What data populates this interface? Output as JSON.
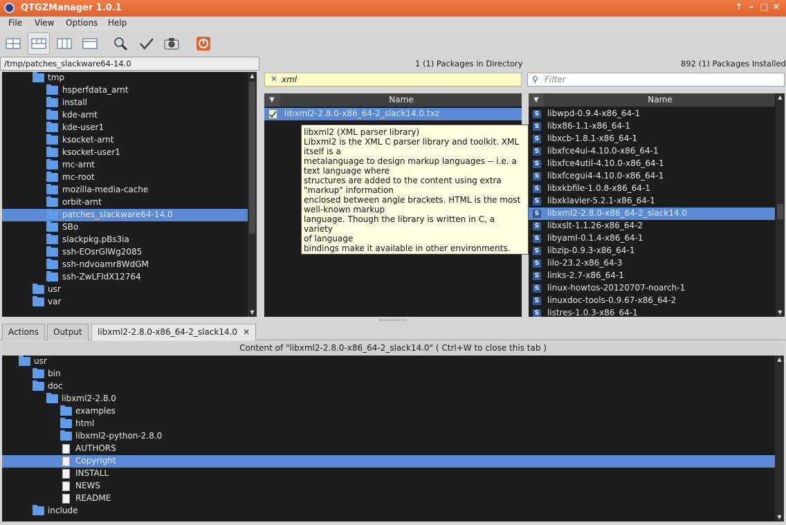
{
  "window": {
    "title": "QTGZManager 1.0.1",
    "controls": [
      "↑",
      "–",
      "□",
      "✕"
    ]
  },
  "menu": [
    "File",
    "View",
    "Options",
    "Help"
  ],
  "toolbar": [
    {
      "name": "view-layout-1-icon",
      "active": false
    },
    {
      "name": "view-layout-2-icon",
      "active": true
    },
    {
      "name": "view-layout-3-icon",
      "active": false
    },
    {
      "name": "view-layout-4-icon",
      "active": false
    },
    {
      "name": "find-icon",
      "active": false
    },
    {
      "name": "check-icon",
      "active": false
    },
    {
      "name": "snapshot-icon",
      "active": false
    },
    {
      "name": "exit-icon",
      "active": false
    }
  ],
  "directory": {
    "path": "/tmp/patches_slackware64-14.0",
    "items": [
      "tmp",
      "hsperfdata_arnt",
      "install",
      "kde-arnt",
      "kde-user1",
      "ksocket-arnt",
      "ksocket-user1",
      "mc-arnt",
      "mc-root",
      "mozilla-media-cache",
      "orbit-arnt",
      "patches_slackware64-14.0",
      "SBo",
      "slackpkg.pBs3ia",
      "ssh-EOsrGlWg2085",
      "ssh-ndvoamr8WdGM",
      "ssh-ZwLFIdX12764",
      "usr",
      "var"
    ],
    "selected": "patches_slackware64-14.0"
  },
  "packages_dir": {
    "count_label": "1 (1) Packages in Directory",
    "search_value": "xml",
    "column": "Name",
    "rows": [
      "libxml2-2.8.0-x86_64-2_slack14.0.txz"
    ]
  },
  "tooltip": {
    "lines": [
      "libxml2 (XML parser library)",
      "Libxml2 is the XML C parser library and toolkit. XML",
      "itself is a",
      "metalanguage to design markup languages -- i.e. a",
      "text language where",
      "structures are added to the content using extra",
      "\"markup\" information",
      "enclosed between angle brackets. HTML is the most",
      "well-known markup",
      "language. Though the library is written in C, a variety",
      "of language",
      "bindings make it available in other environments."
    ]
  },
  "installed": {
    "count_label": "892 (1) Packages Installed",
    "filter_placeholder": "Filter",
    "column": "Name",
    "rows": [
      "libwpd-0.9.4-x86_64-1",
      "libx86-1.1-x86_64-1",
      "libxcb-1.8.1-x86_64-1",
      "libxfce4ui-4.10.0-x86_64-1",
      "libxfce4util-4.10.0-x86_64-1",
      "libxfcegui4-4.10.0-x86_64-1",
      "libxkbfile-1.0.8-x86_64-1",
      "libxklavier-5.2.1-x86_64-1",
      "libxml2-2.8.0-x86_64-2_slack14.0",
      "libxslt-1.1.26-x86_64-2",
      "libyaml-0.1.4-x86_64-1",
      "libzip-0.9.3-x86_64-1",
      "lilo-23.2-x86_64-3",
      "links-2.7-x86_64-1",
      "linux-howtos-20120707-noarch-1",
      "linuxdoc-tools-0.9.67-x86_64-2",
      "listres-1.0.3-x86_64-1"
    ],
    "selected": "libxml2-2.8.0-x86_64-2_slack14.0"
  },
  "tabs": [
    "Actions",
    "Output",
    "libxml2-2.8.0-x86_64-2_slack14.0"
  ],
  "content": {
    "header": "Content of \"libxml2-2.8.0-x86_64-2_slack14.0\" ( Ctrl+W to close this tab )",
    "tree": [
      {
        "label": "usr",
        "type": "folder",
        "depth": 0
      },
      {
        "label": "bin",
        "type": "folder",
        "depth": 1
      },
      {
        "label": "doc",
        "type": "folder",
        "depth": 1
      },
      {
        "label": "libxml2-2.8.0",
        "type": "folder",
        "depth": 2
      },
      {
        "label": "examples",
        "type": "folder",
        "depth": 3
      },
      {
        "label": "html",
        "type": "folder",
        "depth": 3
      },
      {
        "label": "libxml2-python-2.8.0",
        "type": "folder",
        "depth": 3
      },
      {
        "label": "AUTHORS",
        "type": "file",
        "depth": 3
      },
      {
        "label": "Copyright",
        "type": "file",
        "depth": 3
      },
      {
        "label": "INSTALL",
        "type": "file",
        "depth": 3
      },
      {
        "label": "NEWS",
        "type": "file",
        "depth": 3
      },
      {
        "label": "README",
        "type": "file",
        "depth": 3
      },
      {
        "label": "include",
        "type": "folder",
        "depth": 1
      }
    ],
    "selected": "Copyright"
  }
}
